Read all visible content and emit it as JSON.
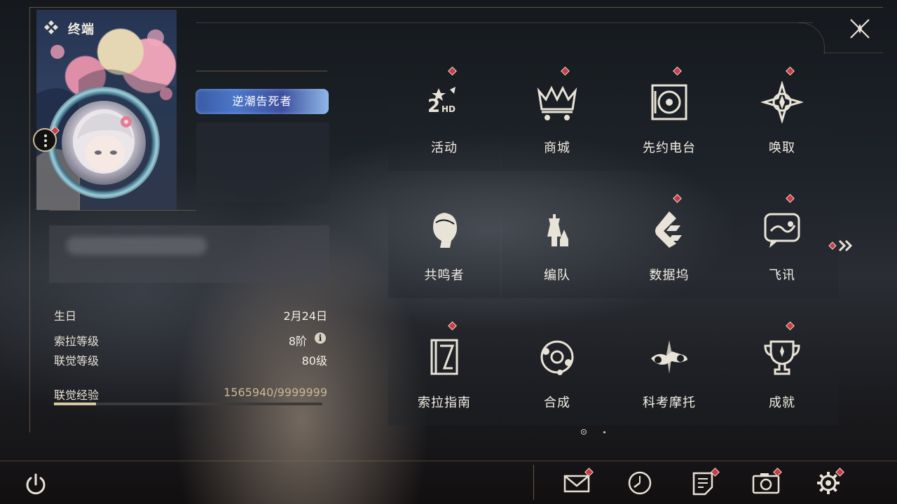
{
  "header": {
    "title": "终端"
  },
  "profile": {
    "title_badge": "逆潮告死者"
  },
  "stats": [
    {
      "label": "生日",
      "value": "2月24日"
    },
    {
      "label": "索拉等级",
      "value": "8阶"
    },
    {
      "label": "联觉等级",
      "value": "80级"
    }
  ],
  "experience": {
    "label": "联觉经验",
    "value": "1565940/9999999",
    "current": 1565940,
    "max": 9999999
  },
  "menu": {
    "items": [
      {
        "label": "活动",
        "icon": "activity-2hd-icon",
        "badge": true
      },
      {
        "label": "商城",
        "icon": "shop-cart-icon",
        "badge": true
      },
      {
        "label": "先约电台",
        "icon": "radio-turntable-icon",
        "badge": true
      },
      {
        "label": "唤取",
        "icon": "compass-star-icon",
        "badge": true
      },
      {
        "label": "共鸣者",
        "icon": "character-head-icon",
        "badge": false
      },
      {
        "label": "编队",
        "icon": "chess-team-icon",
        "badge": false
      },
      {
        "label": "数据坞",
        "icon": "data-dock-icon",
        "badge": true
      },
      {
        "label": "飞讯",
        "icon": "message-bubble-icon",
        "badge": true
      },
      {
        "label": "索拉指南",
        "icon": "guide-book-icon",
        "badge": true
      },
      {
        "label": "合成",
        "icon": "synthesis-orbit-icon",
        "badge": false
      },
      {
        "label": "科考摩托",
        "icon": "motorbike-icon",
        "badge": false
      },
      {
        "label": "成就",
        "icon": "trophy-icon",
        "badge": true
      }
    ],
    "page": 1,
    "page_count": 2
  },
  "bottom_bar": [
    {
      "name": "mail-icon",
      "badge": true
    },
    {
      "name": "clock-icon",
      "badge": false
    },
    {
      "name": "notes-icon",
      "badge": true
    },
    {
      "name": "camera-icon",
      "badge": true
    },
    {
      "name": "settings-gear-icon",
      "badge": true
    }
  ],
  "colors": {
    "accent": "#c93b48",
    "gold": "#8d7a58",
    "text": "#e8e3d6"
  }
}
